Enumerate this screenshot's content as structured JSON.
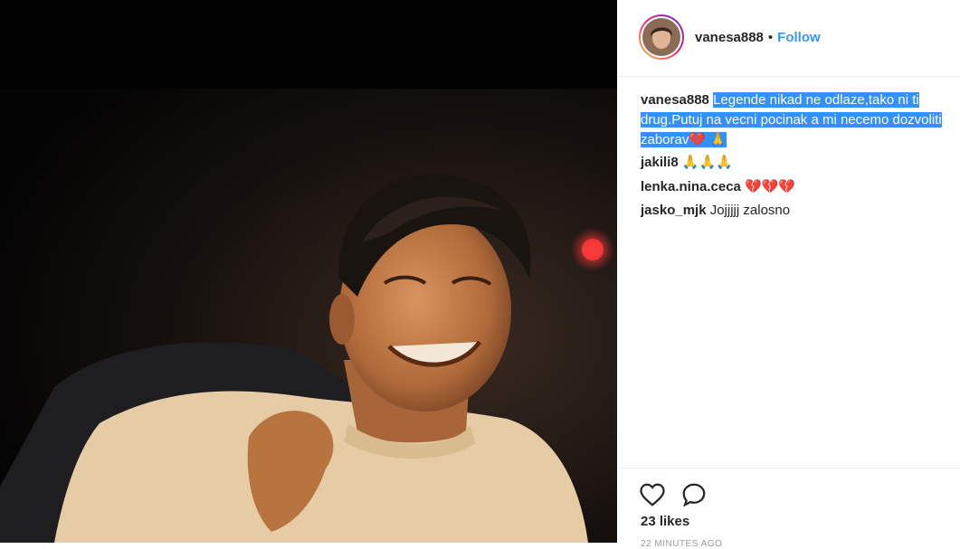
{
  "post": {
    "username": "vanesa888",
    "separator": "•",
    "follow_label": "Follow",
    "caption_username": "vanesa888",
    "caption_text": "Legende nikad ne odlaze,tako ni ti drug.Putuj na vecni pocinak a mi necemo dozvoliti zaborav",
    "caption_emoji": "💔 🙏"
  },
  "comments": [
    {
      "user": "jakili8",
      "text": "🙏🙏🙏"
    },
    {
      "user": "lenka.nina.ceca",
      "text": "💔💔💔"
    },
    {
      "user": "jasko_mjk",
      "text": "Jojjjjj zalosno"
    }
  ],
  "actions": {
    "like_icon": "heart-outline-icon",
    "comment_icon": "comment-bubble-icon",
    "likes_text": "23 likes",
    "time_text": "22 MINUTES AGO"
  },
  "colors": {
    "accent": "#3897f0",
    "selection": "#3390ff"
  }
}
